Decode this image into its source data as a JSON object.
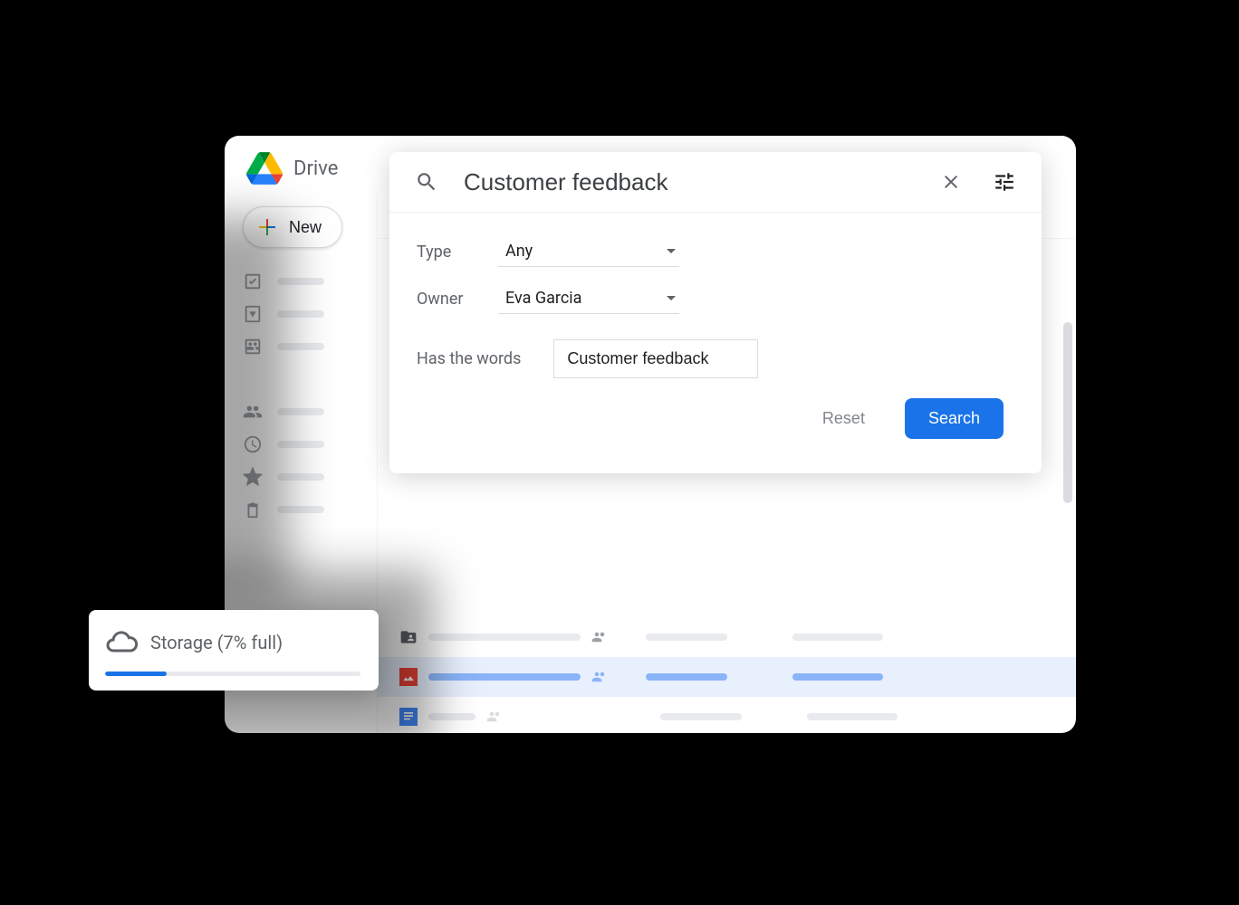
{
  "app": {
    "title": "Drive"
  },
  "sidebar": {
    "new_label": "New"
  },
  "search": {
    "query": "Customer feedback",
    "filters": {
      "type_label": "Type",
      "type_value": "Any",
      "owner_label": "Owner",
      "owner_value": "Eva Garcia",
      "words_label": "Has the words",
      "words_value": "Customer feedback"
    },
    "reset_label": "Reset",
    "search_label": "Search"
  },
  "storage": {
    "label": "Storage (7% full)",
    "percent": 7
  }
}
